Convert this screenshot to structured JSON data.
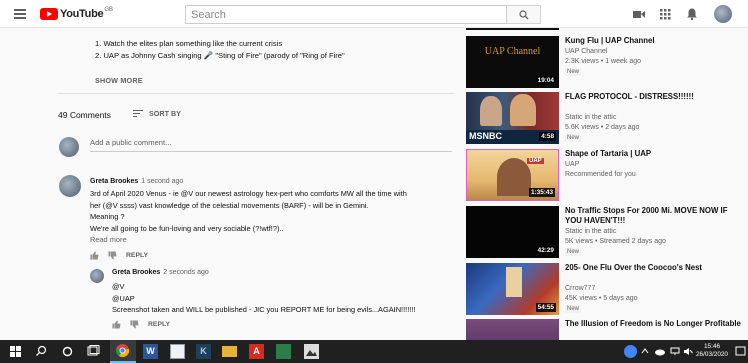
{
  "header": {
    "logo_text": "YouTube",
    "logo_sup": "GB",
    "search_placeholder": "Search"
  },
  "description": {
    "items": [
      "1. Watch the elites plan something like the current crisis",
      "2. UAP as Johnny Cash singing 🎤 \"Sting of Fire\" (parody of \"Ring of Fire\""
    ],
    "show_more": "SHOW MORE"
  },
  "comments": {
    "count": "49 Comments",
    "sort_label": "SORT BY",
    "add_placeholder": "Add a public comment...",
    "list": [
      {
        "author": "Greta Brookes",
        "time": "1 second ago",
        "lines": [
          "3rd of April 2020 Venus - ie @V our newest astrology hex-pert who comforts MW all the time with",
          "her (@V ssss)  vast knowledge of the celestial movements (BARF) - will be in Gemini.",
          "Meaning ?",
          "We're all going to be fun-loving and very sociable (?!wtf!?).."
        ],
        "read_more": "Read more",
        "reply": "REPLY"
      },
      {
        "author": "Greta Brookes",
        "time": "2 seconds ago",
        "lines": [
          "@V",
          "@UAP",
          "Screenshot taken and WILL be published - JIC you REPORT ME for being evils...AGAIN!!!!!!!"
        ],
        "reply": "REPLY"
      }
    ]
  },
  "sidebar": [
    {
      "title": "Kung Flu | UAP Channel",
      "channel": "UAP Channel",
      "meta": "2.3K views • 1 week ago",
      "badge": "New",
      "duration": "19:04",
      "thumb_label": "UAP Channel"
    },
    {
      "title": "FLAG PROTOCOL - DISTRESS!!!!!!",
      "channel": "Static in the attic",
      "meta": "5.6K views • 2 days ago",
      "badge": "New",
      "duration": "4:58",
      "thumb_label": "MSNBC"
    },
    {
      "title": "Shape of Tartaria | UAP",
      "channel": "UAP",
      "meta": "Recommended for you",
      "badge": "",
      "duration": "1:35:43",
      "thumb_label": "UAP"
    },
    {
      "title": "No Traffic Stops For 2000 Mi. MOVE NOW IF YOU HAVEN'T!!!",
      "channel": "Static in the attic",
      "meta": "5K views • Streamed 2 days ago",
      "badge": "New",
      "duration": "42:29",
      "thumb_label": ""
    },
    {
      "title": "205- One Flu Over the Coocoo's Nest",
      "channel": "Crrow777",
      "meta": "45K views • 5 days ago",
      "badge": "New",
      "duration": "54:55",
      "thumb_label": ""
    },
    {
      "title": "The Illusion of Freedom is No Longer Profitable",
      "channel": "",
      "meta": "",
      "badge": "",
      "duration": "",
      "thumb_label": ""
    }
  ],
  "taskbar": {
    "time": "15:46",
    "date": "26/03/2020"
  },
  "colors": {
    "brand_red": "#ff0000",
    "link_blue": "#065fd4",
    "taskbar": "#202020"
  }
}
